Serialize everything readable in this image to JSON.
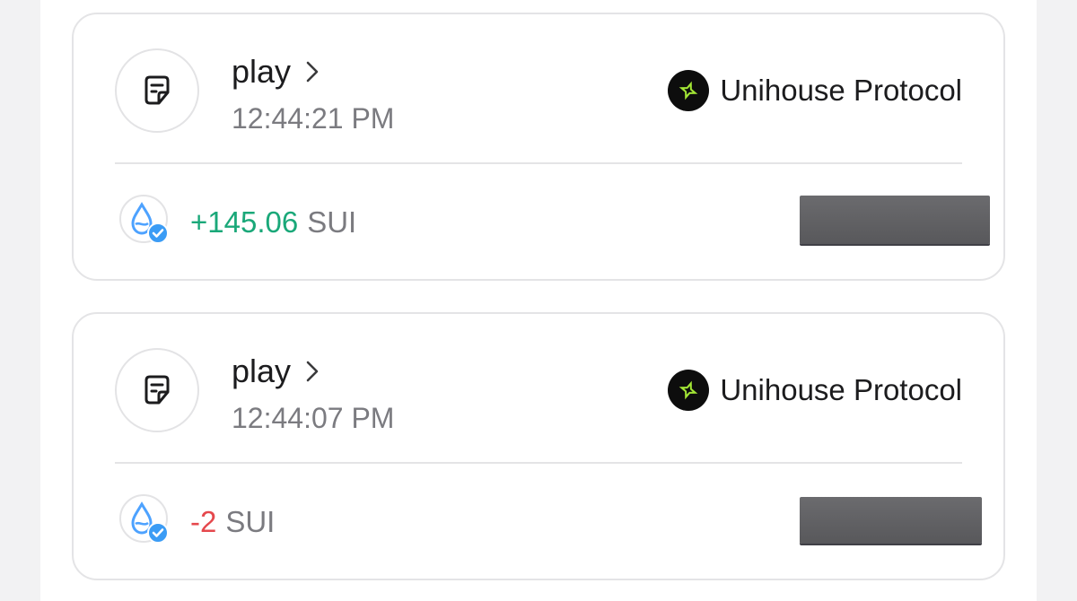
{
  "colors": {
    "positive": "#1aa879",
    "negative": "#e5484d",
    "muted": "#7b7b80",
    "protocol_accent": "#a3e635"
  },
  "transactions": [
    {
      "action_icon": "note-icon",
      "action": "play",
      "time": "12:44:21 PM",
      "protocol_icon": "unihouse-logo-icon",
      "protocol": "Unihouse Protocol",
      "token_icon": "sui-verified-icon",
      "amount": "+145.06",
      "amount_direction": "positive",
      "unit": "SUI"
    },
    {
      "action_icon": "note-icon",
      "action": "play",
      "time": "12:44:07 PM",
      "protocol_icon": "unihouse-logo-icon",
      "protocol": "Unihouse Protocol",
      "token_icon": "sui-verified-icon",
      "amount": "-2",
      "amount_direction": "negative",
      "unit": "SUI"
    }
  ]
}
